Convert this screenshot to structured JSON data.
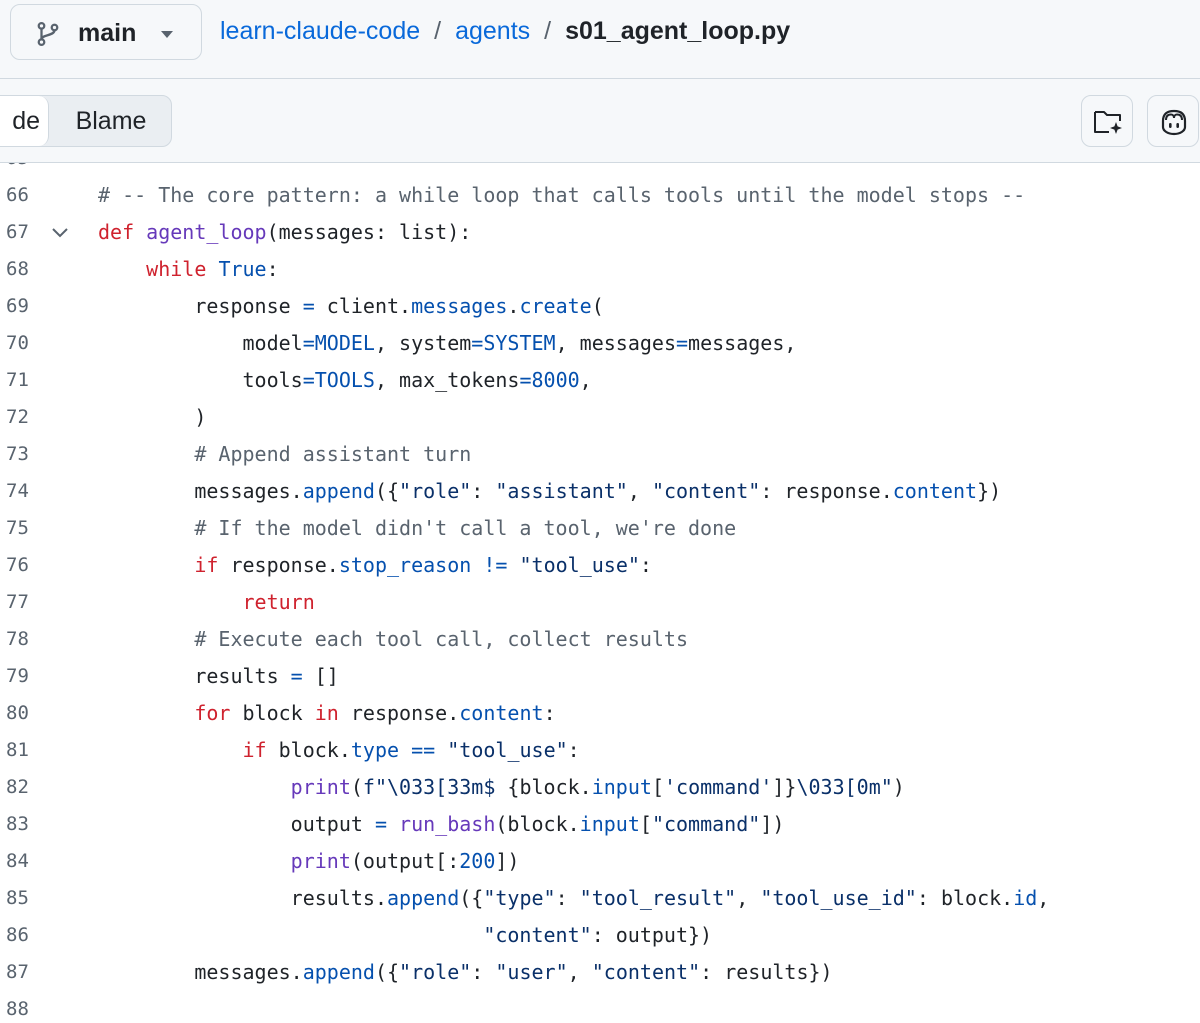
{
  "header": {
    "branch": "main",
    "breadcrumbs": [
      {
        "label": "learn-claude-code"
      },
      {
        "label": "agents"
      }
    ],
    "separator": "/",
    "file": "s01_agent_loop.py"
  },
  "toolbar": {
    "code_tab": "Code",
    "code_tab_visible": "de",
    "blame_tab": "Blame"
  },
  "code": {
    "lines": [
      {
        "num": "66",
        "html": "<span class=\"c\"># -- The core pattern: a while loop that calls tools until the model stops --</span>"
      },
      {
        "num": "67",
        "html": "<span class=\"k\">def</span> <span class=\"f\">agent_loop</span>(messages: list):"
      },
      {
        "num": "68",
        "html": "    <span class=\"k\">while</span> <span class=\"n\">True</span>:"
      },
      {
        "num": "69",
        "html": "        response <span class=\"n\">=</span> client.<span class=\"n\">messages</span>.<span class=\"n\">create</span>("
      },
      {
        "num": "70",
        "html": "            model<span class=\"n\">=MODEL</span>, system<span class=\"n\">=SYSTEM</span>, messages<span class=\"n\">=</span>messages,"
      },
      {
        "num": "71",
        "html": "            tools<span class=\"n\">=TOOLS</span>, max_tokens<span class=\"n\">=8000</span>,"
      },
      {
        "num": "72",
        "html": "        )"
      },
      {
        "num": "73",
        "html": "        <span class=\"c\"># Append assistant turn</span>"
      },
      {
        "num": "74",
        "html": "        messages.<span class=\"n\">append</span>({<span class=\"s\">\"role\"</span>: <span class=\"s\">\"assistant\"</span>, <span class=\"s\">\"content\"</span>: response.<span class=\"n\">content</span>})"
      },
      {
        "num": "75",
        "html": "        <span class=\"c\"># If the model didn't call a tool, we're done</span>"
      },
      {
        "num": "76",
        "html": "        <span class=\"k\">if</span> response.<span class=\"n\">stop_reason</span> <span class=\"n\">!=</span> <span class=\"s\">\"tool_use\"</span>:"
      },
      {
        "num": "77",
        "html": "            <span class=\"k\">return</span>"
      },
      {
        "num": "78",
        "html": "        <span class=\"c\"># Execute each tool call, collect results</span>"
      },
      {
        "num": "79",
        "html": "        results <span class=\"n\">=</span> []"
      },
      {
        "num": "80",
        "html": "        <span class=\"k\">for</span> block <span class=\"k\">in</span> response.<span class=\"n\">content</span>:"
      },
      {
        "num": "81",
        "html": "            <span class=\"k\">if</span> block.<span class=\"n\">type</span> <span class=\"n\">==</span> <span class=\"s\">\"tool_use\"</span>:"
      },
      {
        "num": "82",
        "html": "                <span class=\"f\">print</span>(<span class=\"s\">f\"\\033[33m$ </span>{block.<span class=\"n\">input</span>[<span class=\"s\">'command'</span>]}<span class=\"s\">\\033[0m\"</span>)"
      },
      {
        "num": "83",
        "html": "                output <span class=\"n\">=</span> <span class=\"f\">run_bash</span>(block.<span class=\"n\">input</span>[<span class=\"s\">\"command\"</span>])"
      },
      {
        "num": "84",
        "html": "                <span class=\"f\">print</span>(output[:<span class=\"n\">200</span>])"
      },
      {
        "num": "85",
        "html": "                results.<span class=\"n\">append</span>({<span class=\"s\">\"type\"</span>: <span class=\"s\">\"tool_result\"</span>, <span class=\"s\">\"tool_use_id\"</span>: block.<span class=\"n\">id</span>,"
      },
      {
        "num": "86",
        "html": "                                <span class=\"s\">\"content\"</span>: output})"
      },
      {
        "num": "87",
        "html": "        messages.<span class=\"n\">append</span>({<span class=\"s\">\"role\"</span>: <span class=\"s\">\"user\"</span>, <span class=\"s\">\"content\"</span>: results})"
      },
      {
        "num": "88",
        "html": ""
      }
    ],
    "fold_line": "67"
  },
  "colors": {
    "keyword": "#cf222e",
    "function": "#6639ba",
    "comment": "#59636e",
    "string": "#0a3069",
    "constant": "#0550ae",
    "link": "#0969da"
  },
  "icons": [
    "git-branch-icon",
    "triangle-down-icon",
    "chevron-down-icon",
    "file-directory-icon",
    "copilot-icon"
  ]
}
